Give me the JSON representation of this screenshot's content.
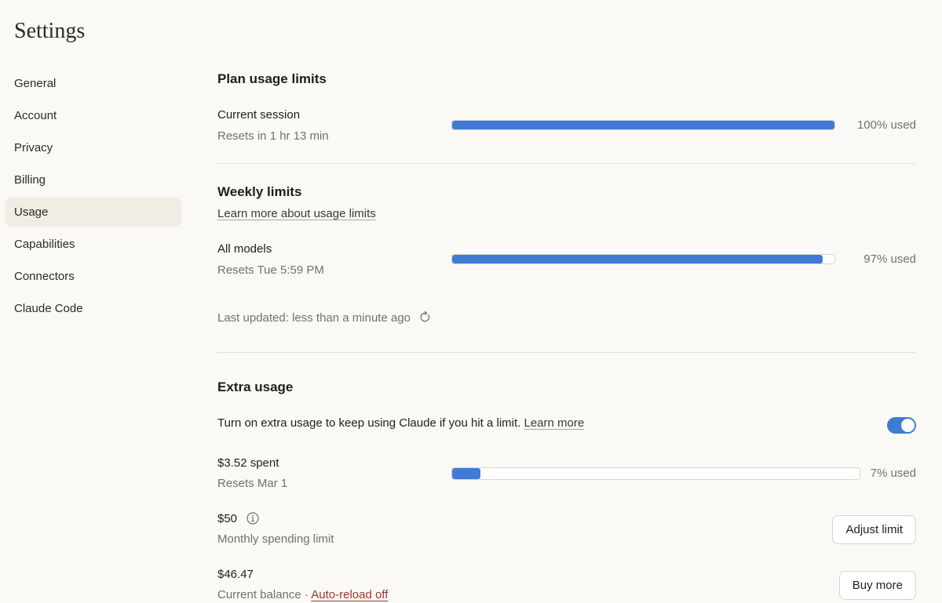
{
  "app": {
    "title": "Settings"
  },
  "sidebar": {
    "items": [
      {
        "label": "General",
        "active": false
      },
      {
        "label": "Account",
        "active": false
      },
      {
        "label": "Privacy",
        "active": false
      },
      {
        "label": "Billing",
        "active": false
      },
      {
        "label": "Usage",
        "active": true
      },
      {
        "label": "Capabilities",
        "active": false
      },
      {
        "label": "Connectors",
        "active": false
      },
      {
        "label": "Claude Code",
        "active": false
      }
    ]
  },
  "plan_usage": {
    "title": "Plan usage limits",
    "current_session": {
      "label": "Current session",
      "reset_text": "Resets in 1 hr 13 min",
      "percent_used": 100,
      "percent_label": "100% used"
    }
  },
  "weekly_limits": {
    "title": "Weekly limits",
    "learn_more": "Learn more about usage limits",
    "all_models": {
      "label": "All models",
      "reset_text": "Resets Tue 5:59 PM",
      "percent_used": 97,
      "percent_label": "97% used"
    },
    "last_updated": "Last updated: less than a minute ago",
    "refresh_icon": "refresh-icon"
  },
  "extra_usage": {
    "title": "Extra usage",
    "description": "Turn on extra usage to keep using Claude if you hit a limit.",
    "learn_more": "Learn more",
    "toggle_on": true,
    "spent": {
      "label": "$3.52 spent",
      "reset_text": "Resets Mar 1",
      "percent_used": 7,
      "percent_label": "7% used"
    },
    "limit": {
      "amount": "$50",
      "info_icon": "info-icon",
      "label": "Monthly spending limit",
      "button": "Adjust limit"
    },
    "balance": {
      "amount": "$46.47",
      "label": "Current balance",
      "separator": "·",
      "auto_reload": "Auto-reload off",
      "button": "Buy more"
    }
  },
  "colors": {
    "background": "#faf9f5",
    "accent": "#3f7bd6",
    "active_nav": "#f1ede5",
    "muted_text": "#73716c",
    "warning_link": "#9a3a2c"
  }
}
